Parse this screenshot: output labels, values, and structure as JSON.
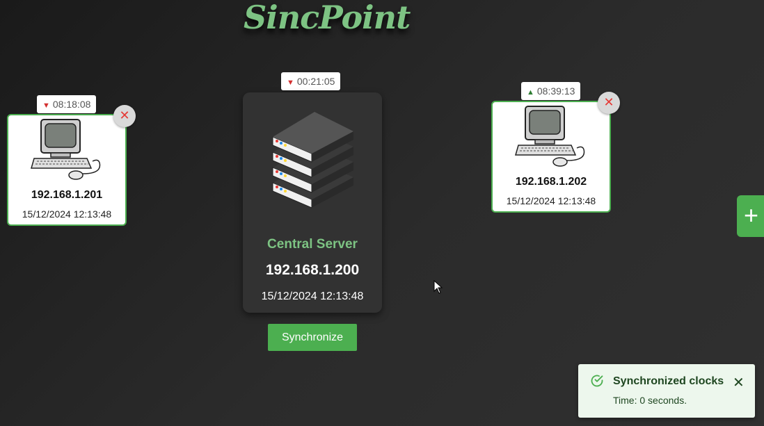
{
  "app": {
    "title": "SincPoint"
  },
  "server": {
    "offset_direction": "down",
    "offset": "00:21:05",
    "name": "Central Server",
    "ip": "192.168.1.200",
    "datetime": "15/12/2024 12:13:48",
    "sync_label": "Synchronize",
    "icon": "server-rack-icon"
  },
  "clients": [
    {
      "offset_direction": "down",
      "offset": "08:18:08",
      "ip": "192.168.1.201",
      "datetime": "15/12/2024 12:13:48",
      "icon": "computer-icon",
      "remove_icon": "close-icon"
    },
    {
      "offset_direction": "up",
      "offset": "08:39:13",
      "ip": "192.168.1.202",
      "datetime": "15/12/2024 12:13:48",
      "icon": "computer-icon",
      "remove_icon": "close-icon"
    }
  ],
  "add_button": {
    "icon": "plus-icon",
    "label": "+"
  },
  "toast": {
    "title": "Synchronized clocks",
    "message": "Time: 0 seconds.",
    "icon": "check-circle-icon",
    "close_icon": "close-icon",
    "status_color": "#4caf50"
  },
  "colors": {
    "accent": "#4caf50",
    "logo": "#7dc383",
    "down": "#d32f2f",
    "up": "#2e7d32"
  }
}
